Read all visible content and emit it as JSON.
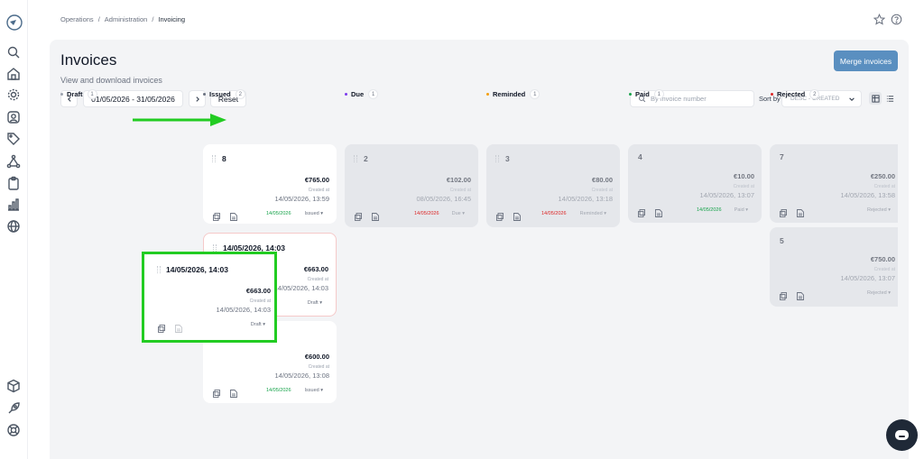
{
  "breadcrumb": [
    "Operations",
    "Administration",
    "Invoicing"
  ],
  "page": {
    "title": "Invoices",
    "subtitle": "View and download invoices",
    "merge_label": "Merge invoices",
    "date_range": "01/05/2026 - 31/05/2026",
    "reset_label": "Reset",
    "search_placeholder": "By invoice number",
    "sort_label": "Sort by",
    "sort_value": "DESC - CREATED"
  },
  "columns": [
    {
      "name": "Draft",
      "count": "1",
      "color": "#9ca3af"
    },
    {
      "name": "Issued",
      "count": "2",
      "color": "#6b7280"
    },
    {
      "name": "Due",
      "count": "1",
      "color": "#7c3aed"
    },
    {
      "name": "Reminded",
      "count": "1",
      "color": "#f59e0b"
    },
    {
      "name": "Paid",
      "count": "1",
      "color": "#16a34a"
    },
    {
      "name": "Rejected",
      "count": "2",
      "color": "#dc2626"
    }
  ],
  "cards": {
    "issued_8": {
      "number": "8",
      "amount": "€765.00",
      "created": "Created at",
      "date": "14/05/2026, 13:59",
      "pay_date": "14/05/2026",
      "status": "Issued"
    },
    "draft_mid": {
      "number": "14/05/2026, 14:03",
      "amount": "€663.00",
      "created": "Created at",
      "date": "14/05/2026, 14:03",
      "status": "Draft"
    },
    "issued_bottom": {
      "amount": "€600.00",
      "created": "Created at",
      "date": "14/05/2026, 13:08",
      "pay_date": "14/05/2026",
      "status": "Issued"
    },
    "due_2": {
      "number": "2",
      "amount": "€102.00",
      "created": "Created at",
      "date": "08/05/2026, 16:45",
      "pay_date": "14/05/2026",
      "status": "Due"
    },
    "reminded_3": {
      "number": "3",
      "amount": "€80.00",
      "created": "Created at",
      "date": "14/05/2026, 13:18",
      "pay_date": "14/05/2026",
      "status": "Reminded"
    },
    "paid_4": {
      "number": "4",
      "amount": "€10.00",
      "created": "Created at",
      "date": "14/05/2026, 13:07",
      "pay_date": "14/05/2026",
      "status": "Paid"
    },
    "rejected_7": {
      "number": "7",
      "amount": "€250.00",
      "created": "Created at",
      "date": "14/05/2026, 13:58",
      "status": "Rejected"
    },
    "rejected_5": {
      "number": "5",
      "amount": "€750.00",
      "created": "Created at",
      "date": "14/05/2026, 13:07",
      "status": "Rejected"
    }
  },
  "dragged_card": {
    "number": "14/05/2026, 14:03",
    "amount": "€663.00",
    "created": "Created at",
    "date": "14/05/2026, 14:03",
    "status": "Draft"
  },
  "icons": {
    "sidebar": [
      "search-icon",
      "home-icon",
      "settings-icon",
      "user-icon",
      "tag-icon",
      "network-icon",
      "clipboard-icon",
      "chart-icon",
      "globe-icon",
      "box-icon",
      "rocket-icon",
      "lifebuoy-icon"
    ],
    "top": [
      "star-icon",
      "help-icon"
    ]
  },
  "accent_colors": {
    "primary": "#5a8fc0",
    "highlight": "#22cc22",
    "paid": "#16a34a",
    "overdue": "#dc2626"
  }
}
